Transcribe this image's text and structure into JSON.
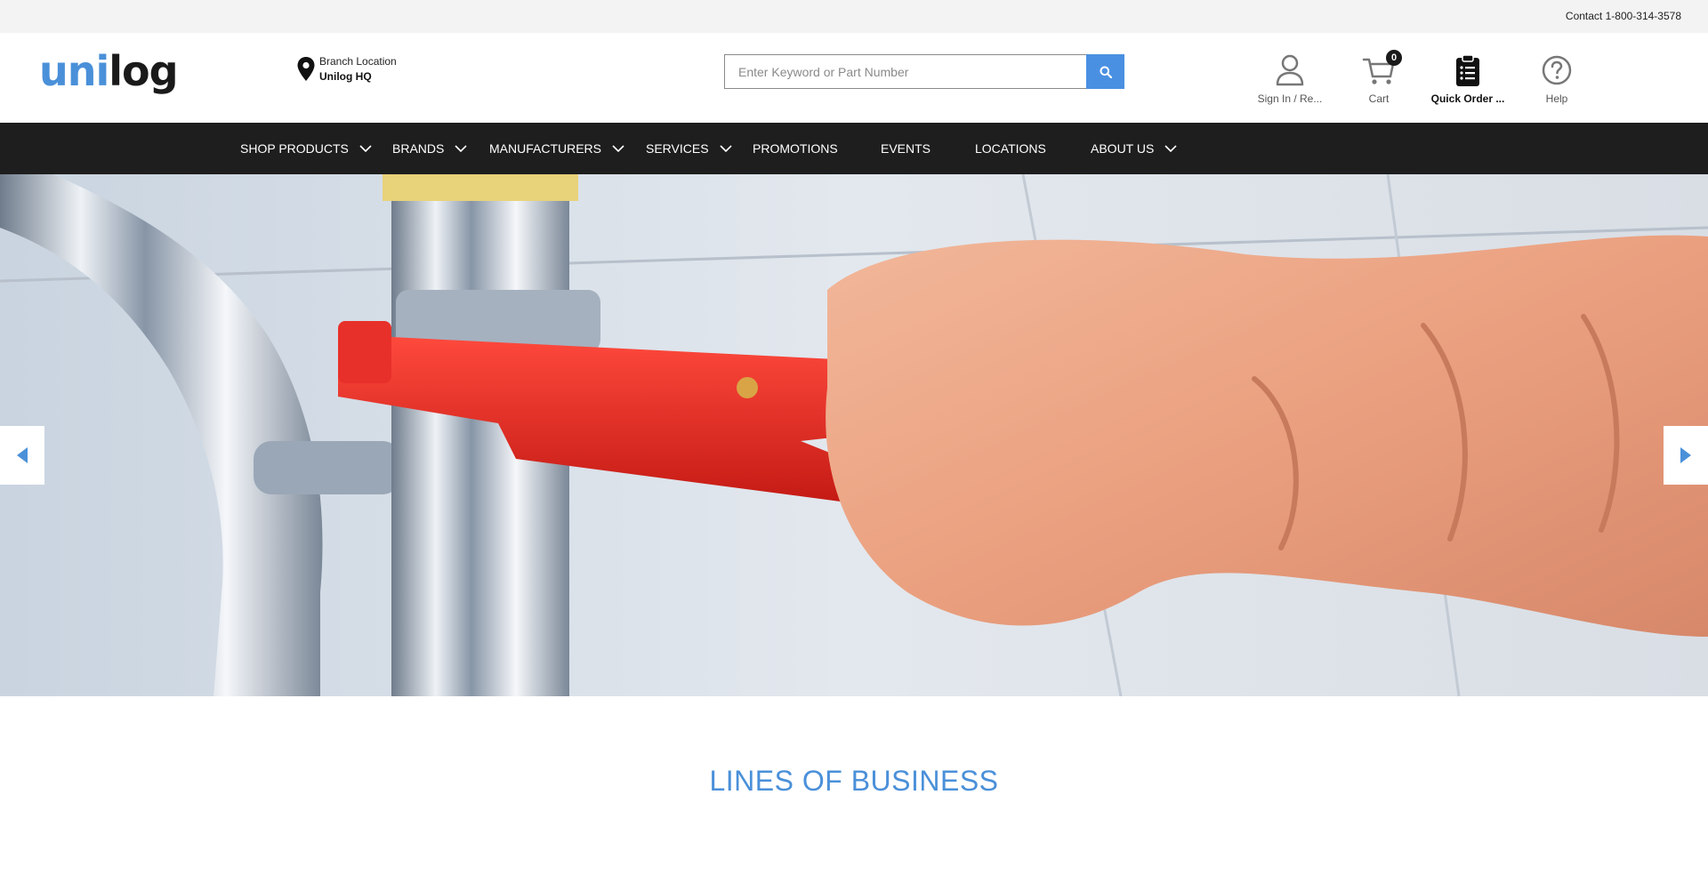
{
  "topbar": {
    "contact": "Contact 1-800-314-3578"
  },
  "header": {
    "logo": {
      "part1": "uni",
      "part2": "log"
    },
    "branch": {
      "label": "Branch Location",
      "value": "Unilog HQ"
    },
    "search": {
      "placeholder": "Enter Keyword or Part Number",
      "value": ""
    },
    "icons": [
      {
        "icon": "user-icon",
        "label": "Sign In / Re..."
      },
      {
        "icon": "cart-icon",
        "label": "Cart",
        "count": "0"
      },
      {
        "icon": "clipboard-icon",
        "label": "Quick Order ..."
      },
      {
        "icon": "help-icon",
        "label": "Help"
      }
    ]
  },
  "nav": {
    "items": [
      {
        "label": "SHOP PRODUCTS",
        "dropdown": true
      },
      {
        "label": "BRANDS",
        "dropdown": true
      },
      {
        "label": "MANUFACTURERS",
        "dropdown": true
      },
      {
        "label": "SERVICES",
        "dropdown": true
      },
      {
        "label": "PROMOTIONS",
        "dropdown": false
      },
      {
        "label": "EVENTS",
        "dropdown": false
      },
      {
        "label": "LOCATIONS",
        "dropdown": false
      },
      {
        "label": "ABOUT US",
        "dropdown": true
      }
    ]
  },
  "hero": {
    "image": "plumbing-wrench-banner"
  },
  "section": {
    "title": "LINES OF BUSINESS"
  },
  "colors": {
    "accent": "#4a90d9",
    "nav_bg": "#1e1e1e",
    "topbar_bg": "#f3f3f3",
    "wrench_red": "#e8302a"
  }
}
